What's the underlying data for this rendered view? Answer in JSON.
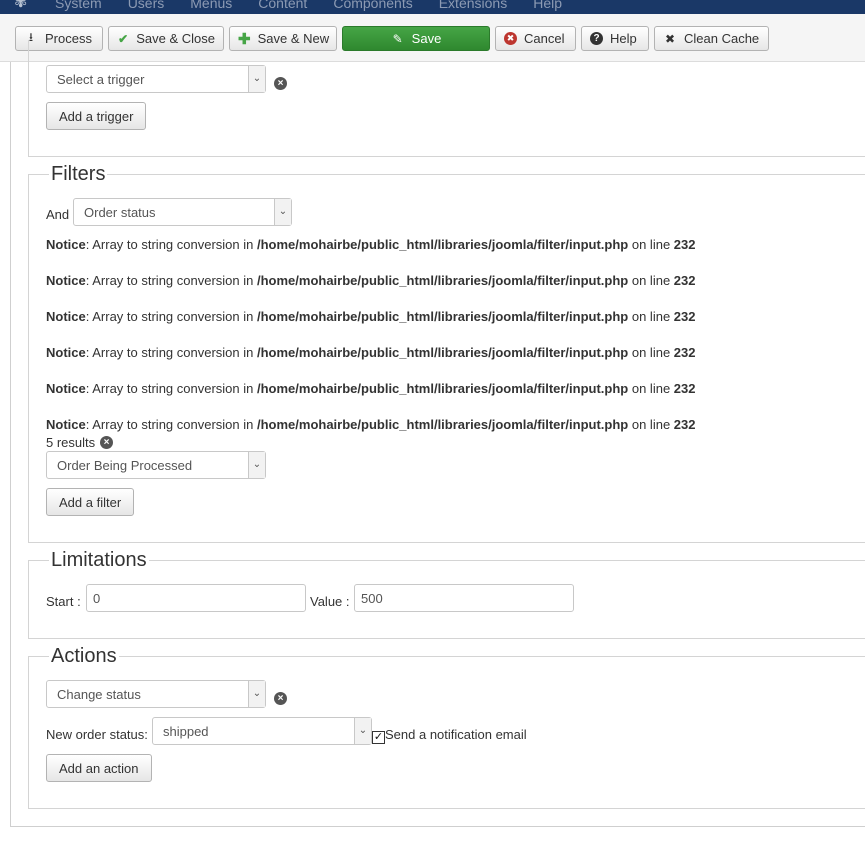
{
  "navbar": {
    "menu": [
      "System",
      "Users",
      "Menus",
      "Content",
      "Components",
      "Extensions",
      "Help"
    ]
  },
  "toolbar": {
    "process": "Process",
    "save_close": "Save & Close",
    "save_new": "Save & New",
    "save": "Save",
    "cancel": "Cancel",
    "help": "Help",
    "clean_cache": "Clean Cache"
  },
  "triggers": {
    "select_value": "Select a trigger",
    "add_button": "Add a trigger"
  },
  "filters": {
    "legend": "Filters",
    "and_label": "And",
    "type_value": "Order status",
    "notice": {
      "label": "Notice",
      "message": ": Array to string conversion in ",
      "path": "/home/mohairbe/public_html/libraries/joomla/filter/input.php",
      "on_line": " on line ",
      "line": "232"
    },
    "results": "5 results",
    "status_value": "Order Being Processed",
    "add_button": "Add a filter"
  },
  "limitations": {
    "legend": "Limitations",
    "start_label": "Start :",
    "start_value": "0",
    "value_label": "Value :",
    "value_value": "500"
  },
  "actions": {
    "legend": "Actions",
    "action_value": "Change status",
    "new_status_label": "New order status:",
    "new_status_value": "shipped",
    "notify_label": "Send a notification email",
    "notify_checked": true,
    "add_button": "Add an action"
  }
}
